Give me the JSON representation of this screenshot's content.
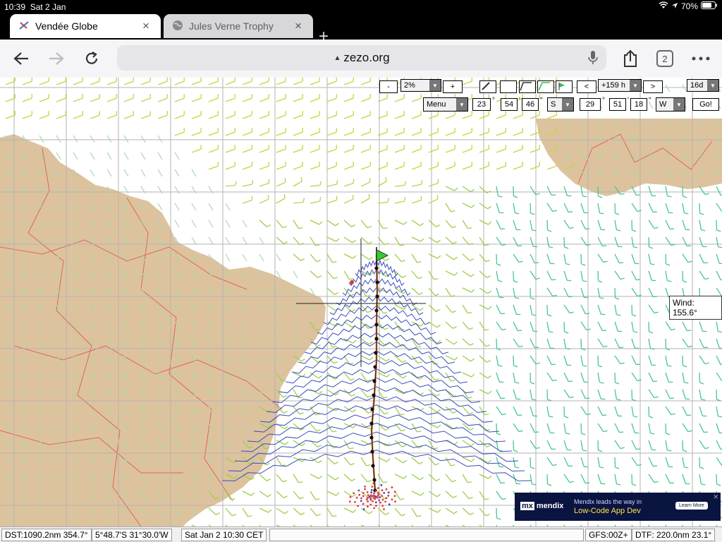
{
  "status_bar": {
    "time": "10:39",
    "date": "Sat 2 Jan",
    "battery": "70%"
  },
  "tabs": [
    {
      "title": "Vendée Globe",
      "active": true
    },
    {
      "title": "Jules Verne Trophy",
      "active": false
    }
  ],
  "address_bar": {
    "url": "zezo.org",
    "tab_count": "2"
  },
  "map_controls": {
    "zoom_minus": "-",
    "zoom_value": "2%",
    "zoom_plus": "+",
    "time_prev": "<",
    "time_offset": "+159 h",
    "time_next": ">",
    "forecast_days": "16d",
    "menu_label": "Menu",
    "lat_deg": "23",
    "lat_min": "54",
    "lat_sec": "46",
    "lat_hem": "S",
    "lon_deg": "29",
    "lon_min": "51",
    "lon_sec": "18",
    "lon_hem": "W",
    "go_label": "Go!",
    "deg_symbol": "°",
    "min_symbol": "'",
    "sec_symbol": "\""
  },
  "wind_label": "Wind: 155.6°",
  "ad": {
    "brand": "mendix",
    "brand_mark": "mx",
    "line1": "Mendix leads the way in",
    "line2": "Low-Code App Dev",
    "cta": "Learn More"
  },
  "bottom_bar": {
    "dst": "DST:1090.2nm 354.7°",
    "position": "5°48.7'S 31°30.0'W",
    "time": "Sat Jan  2 10:30 CET",
    "gfs": "GFS:00Z+",
    "dtf": "DTF: 220.0nm 23.1°"
  },
  "colors": {
    "land": "#dcc39e",
    "border": "#e0645a",
    "grid": "#b3b3b3",
    "isochrone": "#3c4bbd",
    "route": "#e8762f",
    "flag": "#33cc33"
  }
}
